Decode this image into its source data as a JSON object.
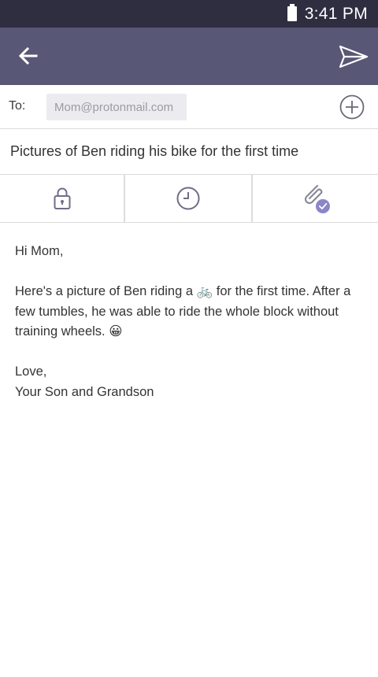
{
  "status_bar": {
    "time": "3:41 PM",
    "battery_icon": "battery-icon"
  },
  "app_bar": {
    "back_icon": "arrow-left-icon",
    "send_icon": "send-icon",
    "background_color": "#585775"
  },
  "compose": {
    "to_label": "To:",
    "recipient": "Mom@protonmail.com",
    "add_icon": "plus-circle-icon",
    "subject": "Pictures of Ben riding his bike for the first time"
  },
  "actions": [
    {
      "icon": "lock-icon"
    },
    {
      "icon": "clock-icon"
    },
    {
      "icon": "paperclip-icon",
      "badge_icon": "check-badge-icon"
    }
  ],
  "message": {
    "greeting": "Hi Mom,",
    "paragraph_part1": "Here's a picture of Ben riding a",
    "bicycle_emoji": "🚲",
    "paragraph_part2": "for the first time. After a few tumbles, he was able to ride the whole block without training wheels.",
    "smile_emoji": "😀",
    "closing": "Love,",
    "signature": "Your Son and Grandson"
  }
}
